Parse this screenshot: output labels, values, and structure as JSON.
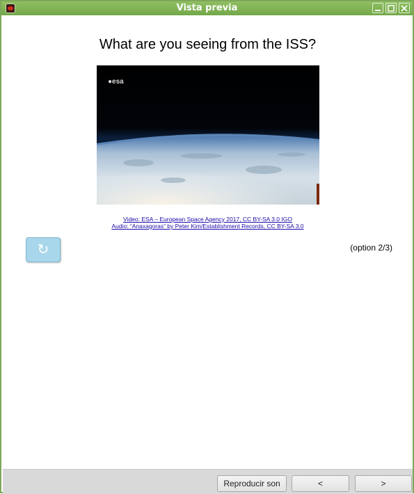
{
  "window": {
    "title": "Vista previa"
  },
  "question": "What are you seeing from the ISS?",
  "video": {
    "logo_text": "esa"
  },
  "credits": {
    "video_line": "Video: ESA – European Space Agency 2017, CC BY-SA 3.0 IGO",
    "audio_line": "Audio: “Anaxagoras” by Peter Kim/Establishment Records, CC BY-SA 3.0"
  },
  "replay_symbol": "↻",
  "option_label": "(option 2/3)",
  "footer": {
    "play_sound": "Reproducir son",
    "prev": "<",
    "next": ">"
  },
  "colors": {
    "titlebar": "#7fa75a",
    "replay_button": "#a8d6ea",
    "link": "#1a0dab"
  },
  "icons": [
    "app-icon",
    "minimize-icon",
    "maximize-icon",
    "close-icon",
    "replay-icon",
    "esa-logo"
  ]
}
